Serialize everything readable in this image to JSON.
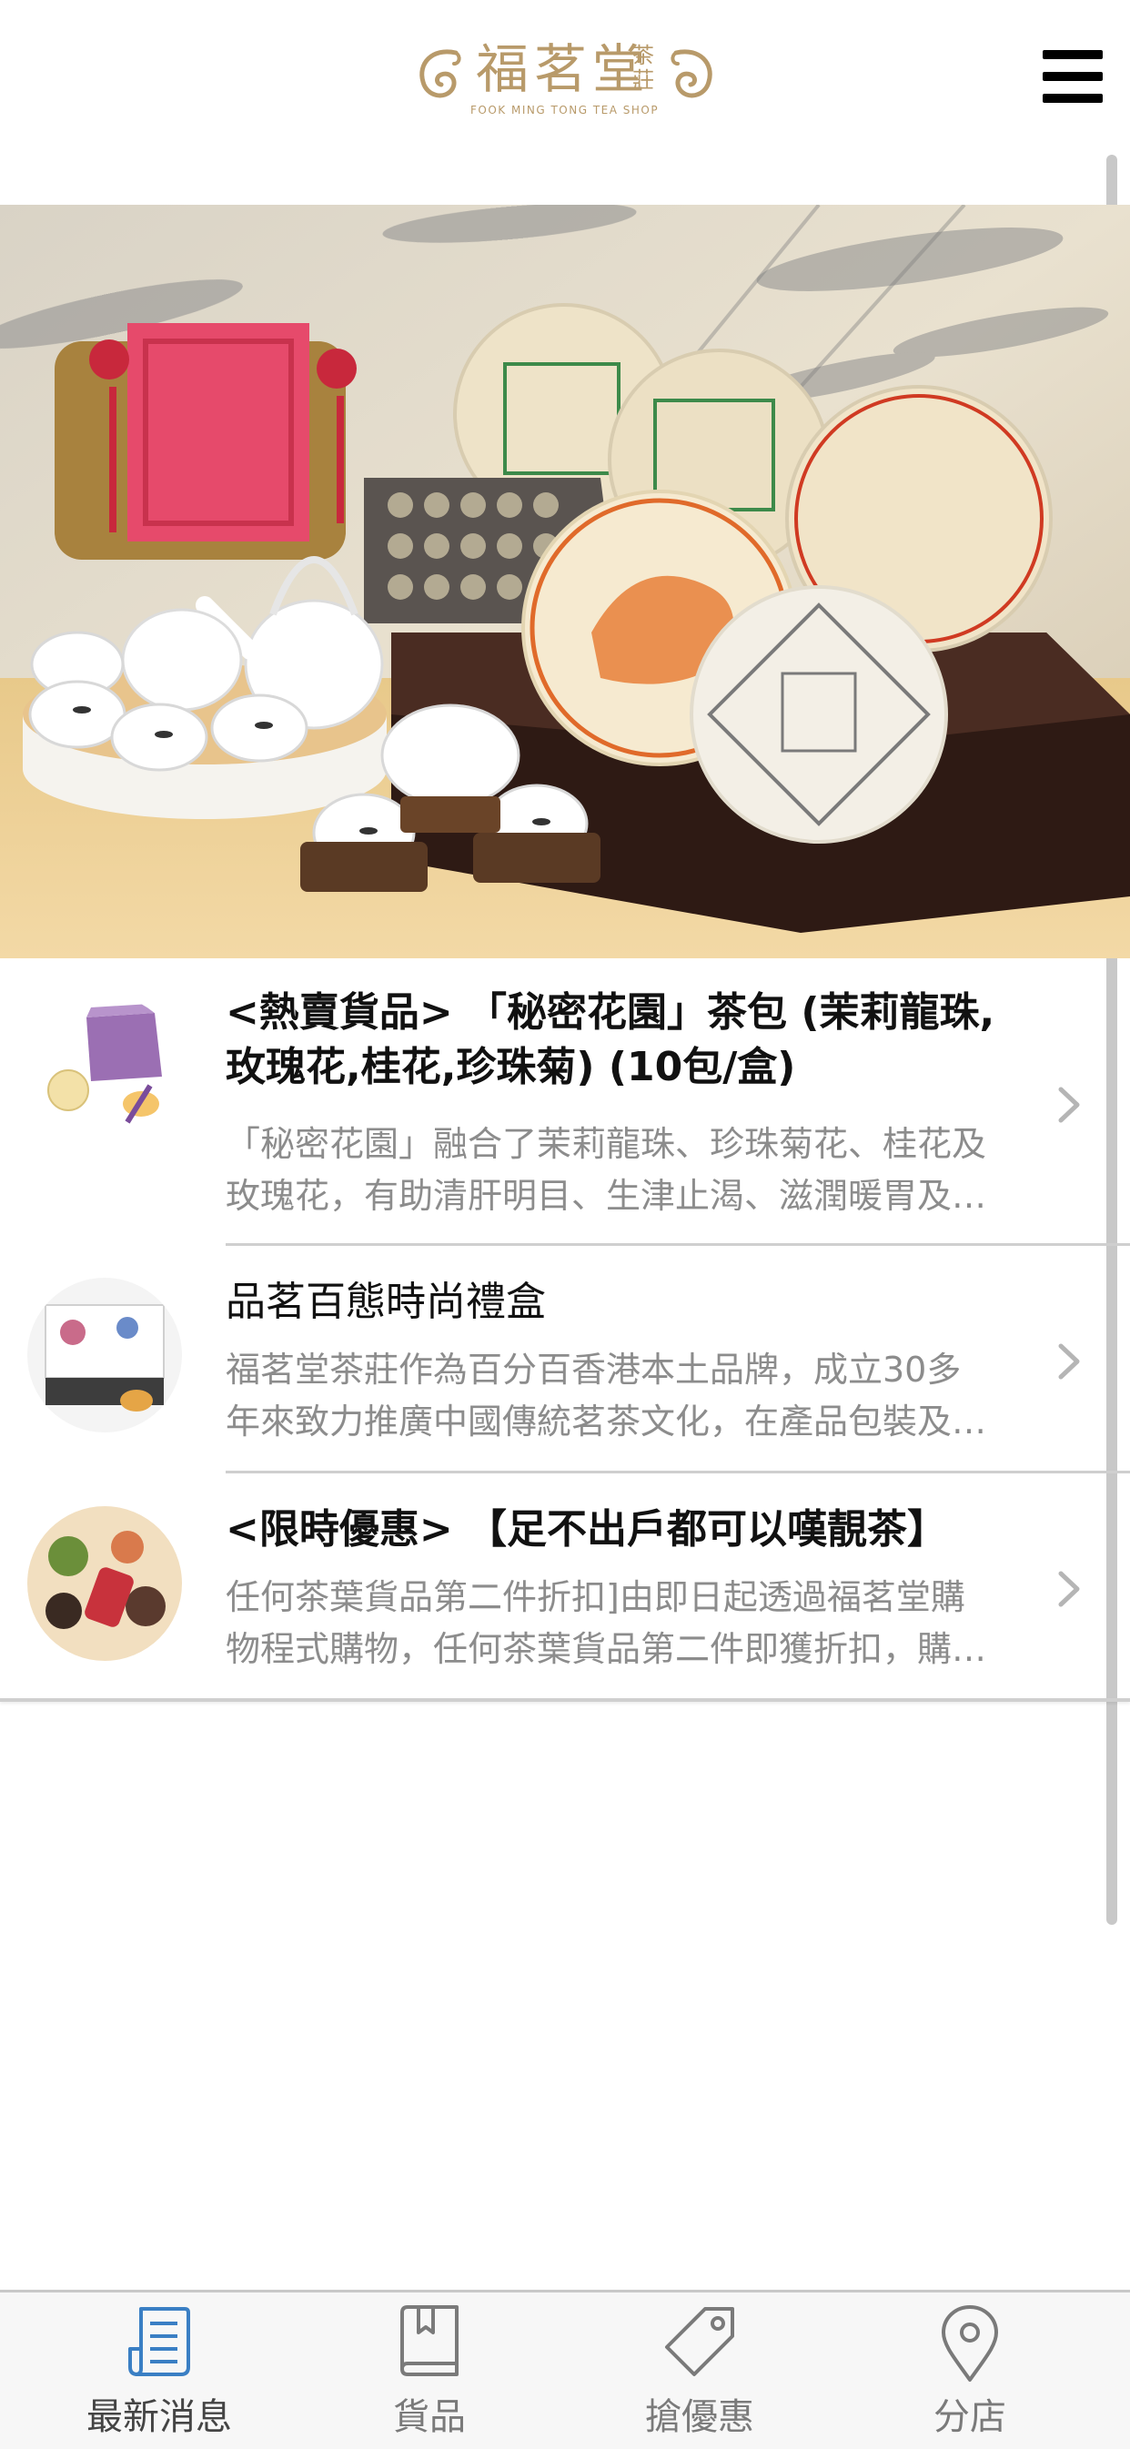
{
  "header": {
    "logo_main": "福茗堂",
    "logo_side": "茶莊",
    "logo_sub": "FOOK MING TONG TEA SHOP",
    "menu_icon": "hamburger-menu-icon"
  },
  "news": [
    {
      "title": "<熱賣貨品> 「秘密花園」茶包 (茉莉龍珠,玫瑰花,桂花,珍珠菊) (10包/盒)",
      "desc_line1": "「秘密花園」融合了茉莉龍珠、珍珠菊花、桂花及",
      "desc_line2": "玫瑰花，有助清肝明目、生津止渴、滋潤暖胃及…"
    },
    {
      "title": "品茗百態時尚禮盒",
      "desc_line1": "福茗堂茶莊作為百分百香港本土品牌，成立30多",
      "desc_line2": "年來致力推廣中國傳統茗茶文化，在產品包裝及…"
    },
    {
      "title": "<限時優惠> 【足不出戶都可以嘆靚茶】",
      "desc_line1": "任何茶葉貨品第二件折扣]由即日起透過福茗堂購",
      "desc_line2": "物程式購物，任何茶葉貨品第二件即獲折扣，購…"
    }
  ],
  "tabs": [
    {
      "label": "最新消息",
      "icon": "news-icon",
      "active": true
    },
    {
      "label": "貨品",
      "icon": "book-icon",
      "active": false
    },
    {
      "label": "搶優惠",
      "icon": "tag-icon",
      "active": false
    },
    {
      "label": "分店",
      "icon": "location-pin-icon",
      "active": false
    }
  ],
  "colors": {
    "brand_gold": "#b89a6a",
    "active_tab": "#3a7fc4",
    "inactive_tab": "#7a7a7a"
  }
}
